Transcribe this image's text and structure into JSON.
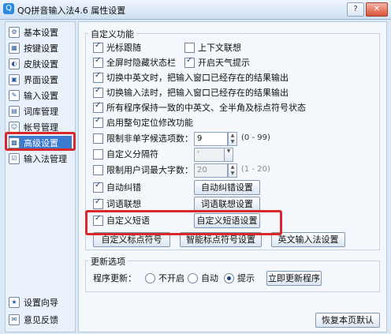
{
  "window": {
    "title": "QQ拼音输入法4.6 属性设置"
  },
  "titlebar": {
    "help": "?",
    "close": "✕"
  },
  "sidebar": {
    "items": [
      {
        "label": "基本设置",
        "icon": "gear-icon"
      },
      {
        "label": "按键设置",
        "icon": "keyboard-icon"
      },
      {
        "label": "皮肤设置",
        "icon": "skin-icon"
      },
      {
        "label": "界面设置",
        "icon": "window-icon"
      },
      {
        "label": "输入设置",
        "icon": "input-icon"
      },
      {
        "label": "词库管理",
        "icon": "book-icon"
      },
      {
        "label": "帐号管理",
        "icon": "user-icon"
      },
      {
        "label": "高级设置",
        "icon": "advanced-icon"
      },
      {
        "label": "输入法管理",
        "icon": "ime-icon"
      }
    ],
    "footer": [
      {
        "label": "设置向导",
        "icon": "wizard-icon"
      },
      {
        "label": "意见反馈",
        "icon": "feedback-icon"
      }
    ]
  },
  "custom": {
    "title": "自定义功能",
    "opt_cursor": "光标跟随",
    "opt_context": "上下文联想",
    "opt_fullscreen": "全屏时隐藏状态栏",
    "opt_weather": "开启天气提示",
    "opt_switch_cn_en": "切换中英文时，把输入窗口已经存在的结果输出",
    "opt_switch_ime": "切换输入法时，把输入窗口已经存在的结果输出",
    "opt_consistent": "所有程序保持一致的中英文、全半角及标点符号状态",
    "opt_whole_sentence": "启用整句定位修改功能",
    "opt_limit_single": "限制非单字候选项数：",
    "limit_single_value": "9",
    "limit_single_range": "(0 - 99)",
    "opt_separator": "自定义分隔符",
    "separator_value": "'",
    "opt_limit_user": "限制用户词最大字数：",
    "limit_user_value": "20",
    "limit_user_range": "(1 - 20)",
    "opt_autocorrect": "自动纠错",
    "btn_autocorrect": "自动纠错设置",
    "opt_association": "词语联想",
    "btn_association": "词语联想设置",
    "opt_phrase": "自定义短语",
    "btn_phrase": "自定义短语设置",
    "btn_punct": "自定义标点符号",
    "btn_smart_punct": "智能标点符号设置",
    "btn_english": "英文输入法设置"
  },
  "update": {
    "title": "更新选项",
    "label": "程序更新：",
    "opt_off": "不开启",
    "opt_auto": "自动",
    "opt_prompt": "提示",
    "btn_now": "立即更新程序"
  },
  "footer": {
    "restore": "恢复本页默认"
  }
}
